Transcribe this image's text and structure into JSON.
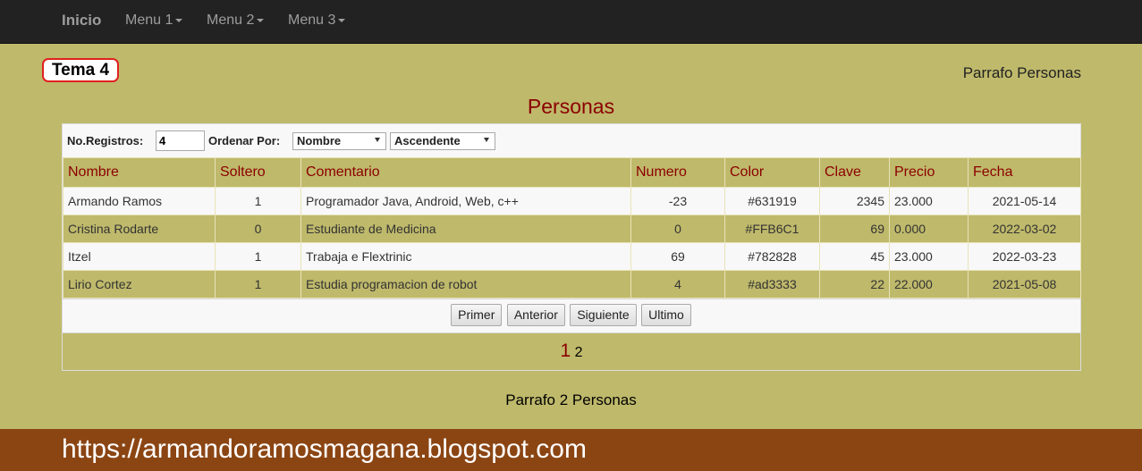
{
  "nav": {
    "brand": "Inicio",
    "menus": [
      "Menu 1",
      "Menu 2",
      "Menu 3"
    ]
  },
  "badge": "Tema 4",
  "parrafo_top": "Parrafo Personas",
  "title": "Personas",
  "filters": {
    "registros_label": "No.Registros:",
    "registros_value": "4",
    "ordenar_label": "Ordenar Por:",
    "ordenar_value": "Nombre",
    "direccion_value": "Ascendente"
  },
  "table": {
    "headers": [
      "Nombre",
      "Soltero",
      "Comentario",
      "Numero",
      "Color",
      "Clave",
      "Precio",
      "Fecha"
    ],
    "rows": [
      [
        "Armando Ramos",
        "1",
        "Programador Java, Android, Web, c++",
        "-23",
        "#631919",
        "2345",
        "23.000",
        "2021-05-14"
      ],
      [
        "Cristina Rodarte",
        "0",
        "Estudiante de Medicina",
        "0",
        "#FFB6C1",
        "69",
        "0.000",
        "2022-03-02"
      ],
      [
        "Itzel",
        "1",
        "Trabaja e Flextrinic",
        "69",
        "#782828",
        "45",
        "23.000",
        "2022-03-23"
      ],
      [
        "Lirio Cortez",
        "1",
        "Estudia programacion de robot",
        "4",
        "#ad3333",
        "22",
        "22.000",
        "2021-05-08"
      ]
    ]
  },
  "pager": {
    "buttons": [
      "Primer",
      "Anterior",
      "Siguiente",
      "Ultimo"
    ],
    "current_page": "1",
    "other_page": "2"
  },
  "parrafo_2": "Parrafo 2 Personas",
  "footer_url": "https://armandoramosmagana.blogspot.com",
  "colors": {
    "navbar": "#222222",
    "background": "#bfb96b",
    "title": "#8b0000",
    "footer": "#8b4513"
  }
}
